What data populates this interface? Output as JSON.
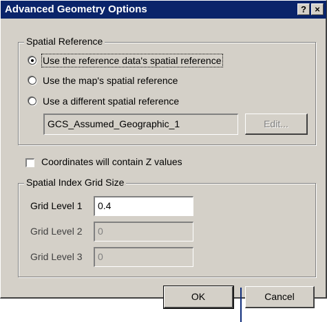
{
  "window": {
    "title": "Advanced Geometry Options",
    "help_label": "?",
    "close_label": "×"
  },
  "spatial_reference": {
    "legend": "Spatial Reference",
    "options": [
      {
        "label": "Use the reference data's spatial reference",
        "checked": true
      },
      {
        "label": "Use the map's spatial reference",
        "checked": false
      },
      {
        "label": "Use a different spatial reference",
        "checked": false
      }
    ],
    "reference_name": "GCS_Assumed_Geographic_1",
    "edit_label": "Edit..."
  },
  "z_values": {
    "label": "Coordinates will contain Z values",
    "checked": false
  },
  "grid": {
    "legend": "Spatial Index Grid Size",
    "levels": [
      {
        "label": "Grid Level 1",
        "value": "0.4",
        "enabled": true
      },
      {
        "label": "Grid Level 2",
        "value": "0",
        "enabled": false
      },
      {
        "label": "Grid Level 3",
        "value": "0",
        "enabled": false
      }
    ]
  },
  "buttons": {
    "ok_label": "OK",
    "cancel_label": "Cancel"
  },
  "colors": {
    "titlebar": "#0a246a",
    "face": "#d4d0c8",
    "pointer": "#0d2b7a"
  }
}
